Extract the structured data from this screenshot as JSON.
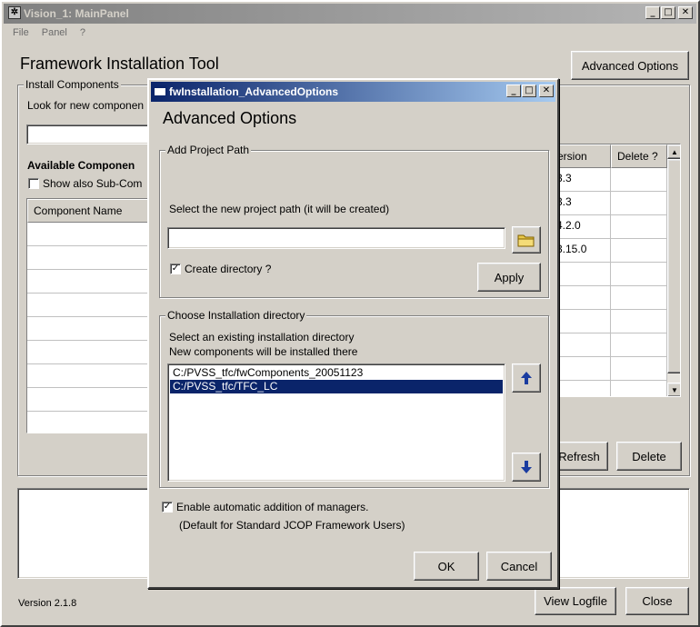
{
  "main_window": {
    "title": "Vision_1: MainPanel",
    "menu": [
      "File",
      "Panel",
      "?"
    ],
    "heading": "Framework Installation Tool",
    "advanced_options_button": "Advanced Options",
    "install_components_group": "Install Components",
    "look_for_label": "Look for new componen",
    "available_components_label": "Available Componen",
    "show_sub_components_label": "Show also Sub-Com",
    "component_name_header": "Component Name",
    "version_header": "ersion",
    "delete_header": "Delete ?",
    "versions": [
      "3.3",
      "3.3",
      "4.2.0",
      "3.15.0"
    ],
    "refresh_button": "Refresh",
    "delete_button": "Delete",
    "version_text": "Version 2.1.8",
    "view_logfile_button": "View Logfile",
    "close_button": "Close"
  },
  "dialog": {
    "title": "fwInstallation_AdvancedOptions",
    "heading": "Advanced Options",
    "add_project_path_group": "Add Project Path",
    "select_path_label": "Select the new project path (it will be created)",
    "path_input_value": "",
    "create_directory_label": "Create directory ?",
    "create_directory_checked": "✓",
    "apply_button": "Apply",
    "choose_dir_group": "Choose Installation directory",
    "choose_dir_line1": "Select an existing installation directory",
    "choose_dir_line2": "New components will be installed there",
    "directories": [
      "C:/PVSS_tfc/fwComponents_20051123",
      "C:/PVSS_tfc/TFC_LC"
    ],
    "selected_directory_index": 1,
    "enable_managers_label": "Enable automatic addition of managers.",
    "enable_managers_checked": "✓",
    "default_note": "(Default for Standard JCOP Framework Users)",
    "ok_button": "OK",
    "cancel_button": "Cancel"
  },
  "icons": {
    "folder": "folder-icon",
    "up": "arrow-up-icon",
    "down": "arrow-down-icon",
    "app": "app-icon"
  },
  "colors": {
    "selection": "#0a246a",
    "arrow": "#1a3ca0",
    "folder": "#e8c84a"
  }
}
